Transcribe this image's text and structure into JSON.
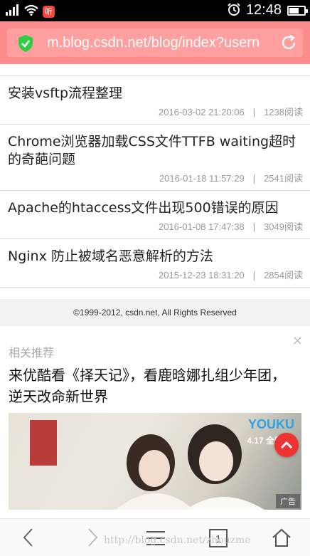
{
  "status_bar": {
    "badge": "听",
    "time": "12:48",
    "icons": [
      "signal-icon",
      "wifi-icon",
      "alarm-icon",
      "battery-icon"
    ]
  },
  "address_bar": {
    "url": "m.blog.csdn.net/blog/index?usern",
    "secure_icon": "shield-check-icon",
    "reload_icon": "reload-icon"
  },
  "articles": [
    {
      "title": "安装vsftp流程整理",
      "date": "2016-03-02 21:20:06",
      "separator": "|",
      "reads": "1238阅读"
    },
    {
      "title": "Chrome浏览器加载CSS文件TTFB waiting超时的奇葩问题",
      "date": "2016-01-18 11:57:29",
      "separator": "|",
      "reads": "2541阅读"
    },
    {
      "title": "Apache的htaccess文件出现500错误的原因",
      "date": "2016-01-08 17:47:38",
      "separator": "|",
      "reads": "3049阅读"
    },
    {
      "title": "Nginx 防止被域名恶意解析的方法",
      "date": "2015-12-23 18:31:20",
      "separator": "|",
      "reads": "2854阅读"
    }
  ],
  "footer": {
    "copyright": "©1999-2012, csdn.net, All Rights Reserved"
  },
  "recommend": {
    "label": "相关推荐",
    "close": "×",
    "title": "来优酷看《择天记》，看鹿晗娜扎组少年团，逆天改命新世界",
    "banner_brand": "YOUKU",
    "banner_date": "4.17 全网",
    "ad_badge": "广告"
  },
  "bottom_nav": {
    "tab_count": "1",
    "icons": [
      "back-icon",
      "forward-icon",
      "menu-icon",
      "tabs-icon",
      "home-icon"
    ]
  },
  "watermark": "http://blog.csdn.net/zhouzme",
  "colors": {
    "address_bar": "#fc8b8b",
    "shield": "#2ecc40",
    "accent_red": "#ee3333"
  }
}
